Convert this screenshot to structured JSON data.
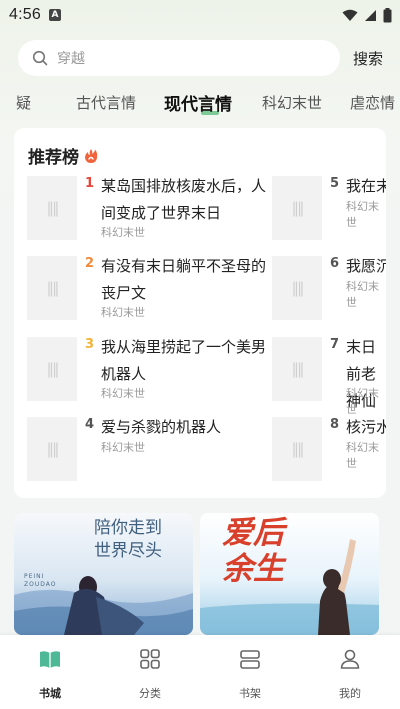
{
  "status": {
    "time": "4:56",
    "notif": "A"
  },
  "search": {
    "placeholder": "穿越",
    "button": "搜索"
  },
  "tabs": [
    {
      "label": "疑"
    },
    {
      "label": "古代言情"
    },
    {
      "label": "现代言情"
    },
    {
      "label": "科幻末世"
    },
    {
      "label": "虐恋情"
    }
  ],
  "ranking": {
    "title": "推荐榜",
    "cover_mark": "‖‖",
    "books": [
      {
        "rank": "1",
        "title": "某岛国排放核废水后，人间变成了世界末日",
        "category": "科幻末世"
      },
      {
        "rank": "2",
        "title": "有没有末日躺平不圣母的丧尸文",
        "category": "科幻末世"
      },
      {
        "rank": "3",
        "title": "我从海里捞起了一个美男机器人",
        "category": "科幻末世"
      },
      {
        "rank": "4",
        "title": "爱与杀戮的机器人",
        "category": "科幻末世"
      },
      {
        "rank": "5",
        "title": "我在末",
        "category": "科幻末世"
      },
      {
        "rank": "6",
        "title": "我愿沉",
        "category": "科幻末世"
      },
      {
        "rank": "7",
        "title": "末日前老神仙",
        "category": "科幻末世"
      },
      {
        "rank": "8",
        "title": "核污水",
        "category": "科幻末世"
      }
    ]
  },
  "banners": [
    {
      "title": "陪你走到世界尽头",
      "subtitle": "PEINI ZOUDAO"
    },
    {
      "title": "爱后余生"
    }
  ],
  "nav": [
    {
      "label": "书城",
      "icon": "book-icon",
      "active": true
    },
    {
      "label": "分类",
      "icon": "grid-icon",
      "active": false
    },
    {
      "label": "书架",
      "icon": "shelf-icon",
      "active": false
    },
    {
      "label": "我的",
      "icon": "user-icon",
      "active": false
    }
  ],
  "colors": {
    "rank1": "#e8453c",
    "rank2": "#f08a3c",
    "rank3": "#f2b43a",
    "rank_other": "#555555",
    "accent": "#5fbf7f"
  }
}
